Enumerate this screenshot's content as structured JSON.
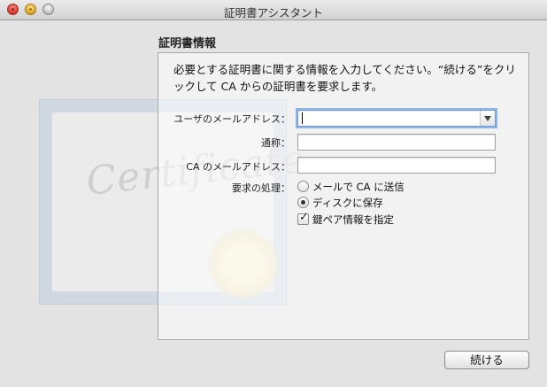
{
  "window": {
    "title": "証明書アシスタント"
  },
  "section": {
    "title": "証明書情報"
  },
  "intro": {
    "text": "必要とする証明書に関する情報を入力してください。“続ける”をクリックして CA からの証明書を要求します。"
  },
  "certificate_bg": {
    "script_text": "Certificate"
  },
  "form": {
    "user_email": {
      "label": "ユーザのメールアドレス：",
      "value": ""
    },
    "common_name": {
      "label": "通称：",
      "value": ""
    },
    "ca_email": {
      "label": "CA のメールアドレス：",
      "value": ""
    },
    "request": {
      "label": "要求の処理：",
      "options": [
        {
          "label": "メールで CA に送信",
          "selected": false
        },
        {
          "label": "ディスクに保存",
          "selected": true
        }
      ]
    },
    "key_pair": {
      "label": "鍵ペア情報を指定",
      "checked": true
    }
  },
  "footer": {
    "continue_label": "続ける"
  }
}
